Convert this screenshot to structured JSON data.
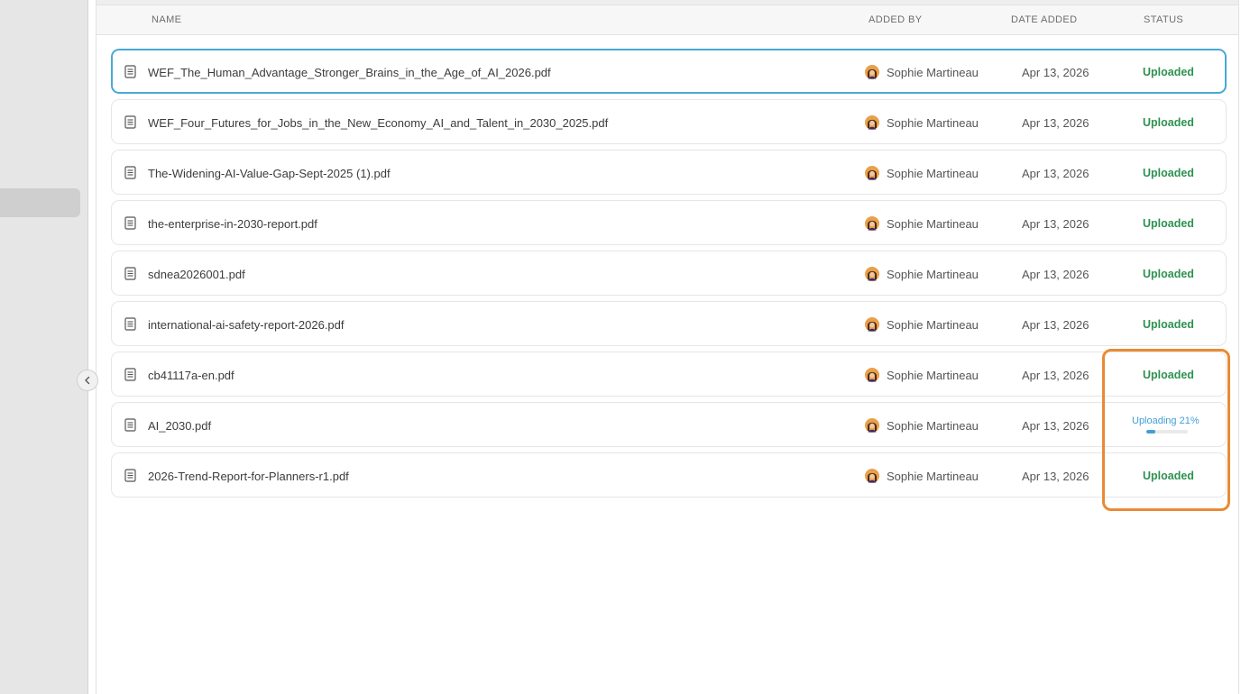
{
  "columns": {
    "name": "NAME",
    "added_by": "ADDED BY",
    "date_added": "DATE ADDED",
    "status": "STATUS"
  },
  "files": [
    {
      "name": "WEF_The_Human_Advantage_Stronger_Brains_in_the_Age_of_AI_2026.pdf",
      "added_by": "Sophie Martineau",
      "date": "Apr 13, 2026",
      "status": "Uploaded",
      "selected": true
    },
    {
      "name": "WEF_Four_Futures_for_Jobs_in_the_New_Economy_AI_and_Talent_in_2030_2025.pdf",
      "added_by": "Sophie Martineau",
      "date": "Apr 13, 2026",
      "status": "Uploaded"
    },
    {
      "name": "The-Widening-AI-Value-Gap-Sept-2025 (1).pdf",
      "added_by": "Sophie Martineau",
      "date": "Apr 13, 2026",
      "status": "Uploaded"
    },
    {
      "name": "the-enterprise-in-2030-report.pdf",
      "added_by": "Sophie Martineau",
      "date": "Apr 13, 2026",
      "status": "Uploaded"
    },
    {
      "name": "sdnea2026001.pdf",
      "added_by": "Sophie Martineau",
      "date": "Apr 13, 2026",
      "status": "Uploaded"
    },
    {
      "name": "international-ai-safety-report-2026.pdf",
      "added_by": "Sophie Martineau",
      "date": "Apr 13, 2026",
      "status": "Uploaded"
    },
    {
      "name": "cb41117a-en.pdf",
      "added_by": "Sophie Martineau",
      "date": "Apr 13, 2026",
      "status": "Uploaded"
    },
    {
      "name": "AI_2030.pdf",
      "added_by": "Sophie Martineau",
      "date": "Apr 13, 2026",
      "status": "Uploading 21%",
      "progress": 0.21
    },
    {
      "name": "2026-Trend-Report-for-Planners-r1.pdf",
      "added_by": "Sophie Martineau",
      "date": "Apr 13, 2026",
      "status": "Uploaded"
    }
  ],
  "icons": {
    "file": "document-icon",
    "avatar": "user-avatar",
    "collapse": "chevron-left-icon"
  },
  "colors": {
    "uploaded": "#2e9150",
    "uploading": "#3f9fd6",
    "selected_border": "#48a9d6",
    "highlight": "#e98b35"
  }
}
